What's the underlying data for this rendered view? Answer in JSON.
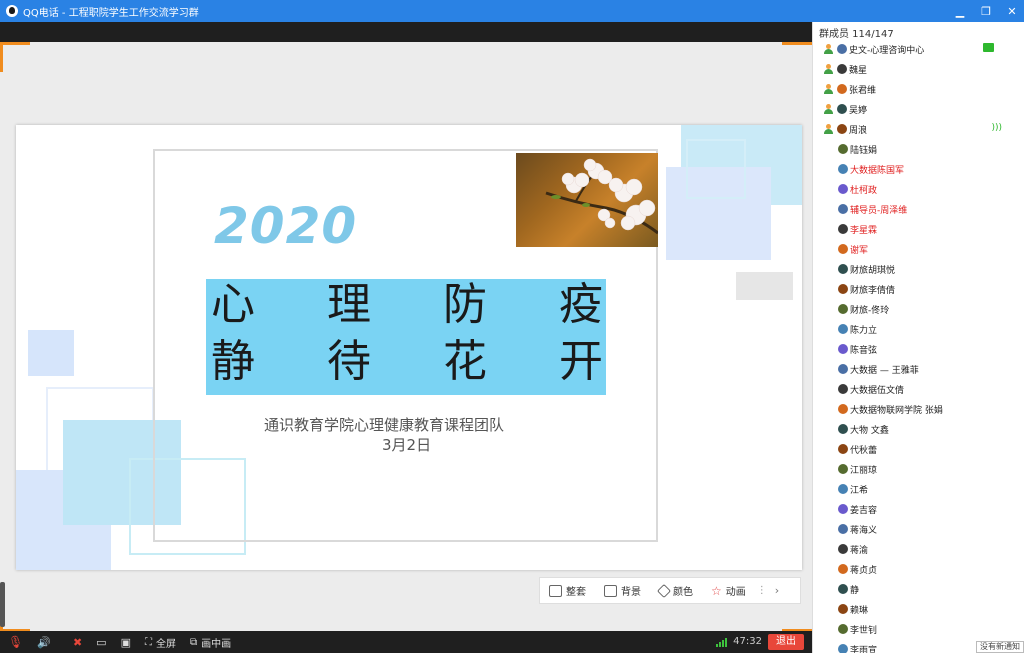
{
  "window": {
    "title": "QQ电话 - 工程职院学生工作交流学习群",
    "controls": [
      "minimize",
      "restore",
      "close"
    ]
  },
  "slide": {
    "year": "2020",
    "headline_row1": [
      "心",
      "理",
      "防",
      "疫"
    ],
    "headline_row2": [
      "静",
      "待",
      "花",
      "开"
    ],
    "subtitle": "通识教育学院心理健康教育课程团队",
    "date": "3月2日",
    "colors": {
      "headline_bg": "#7ad3f3",
      "year": "#7fc8e8",
      "deco_blue": "#bfe6f6"
    }
  },
  "slide_toolbar": {
    "buttons": [
      "整套",
      "背景",
      "颜色",
      "动画"
    ],
    "more": "⋮",
    "next": "›"
  },
  "bottombar": {
    "fullscreen": "全屏",
    "pip": "画中画",
    "timer": "47:32",
    "exit": "退出"
  },
  "members": {
    "header": "群成员 114/147",
    "list": [
      {
        "name": "史文-心理咨询中心",
        "speaking": true,
        "extra": "screen"
      },
      {
        "name": "魏星",
        "speaking": true
      },
      {
        "name": "张君维",
        "speaking": true
      },
      {
        "name": "吴婷",
        "speaking": true
      },
      {
        "name": "周浪",
        "speaking": true,
        "extra": "wave"
      },
      {
        "name": "陆钰娟"
      },
      {
        "name": "大数据陈国军",
        "red": true
      },
      {
        "name": "杜柯政",
        "red": true
      },
      {
        "name": "辅导员-周泽维",
        "red": true
      },
      {
        "name": "李星霖",
        "red": true
      },
      {
        "name": "谢军",
        "red": true
      },
      {
        "name": "财旅胡琪悦"
      },
      {
        "name": "财旅李倩倩"
      },
      {
        "name": "财旅-佟玲"
      },
      {
        "name": "陈力立"
      },
      {
        "name": "陈音弦"
      },
      {
        "name": "大数据 — 王雅菲"
      },
      {
        "name": "大数据伍文倩"
      },
      {
        "name": "大数据物联网学院 张娟"
      },
      {
        "name": "大物 文鑫"
      },
      {
        "name": "代秋蕾"
      },
      {
        "name": "江丽琼"
      },
      {
        "name": "江希"
      },
      {
        "name": "姜吉容"
      },
      {
        "name": "蒋海义"
      },
      {
        "name": "蒋渝"
      },
      {
        "name": "蒋贞贞"
      },
      {
        "name": "静"
      },
      {
        "name": "赖琳"
      },
      {
        "name": "李世钊"
      },
      {
        "name": "李雨宣"
      }
    ],
    "notice": "没有新通知"
  }
}
